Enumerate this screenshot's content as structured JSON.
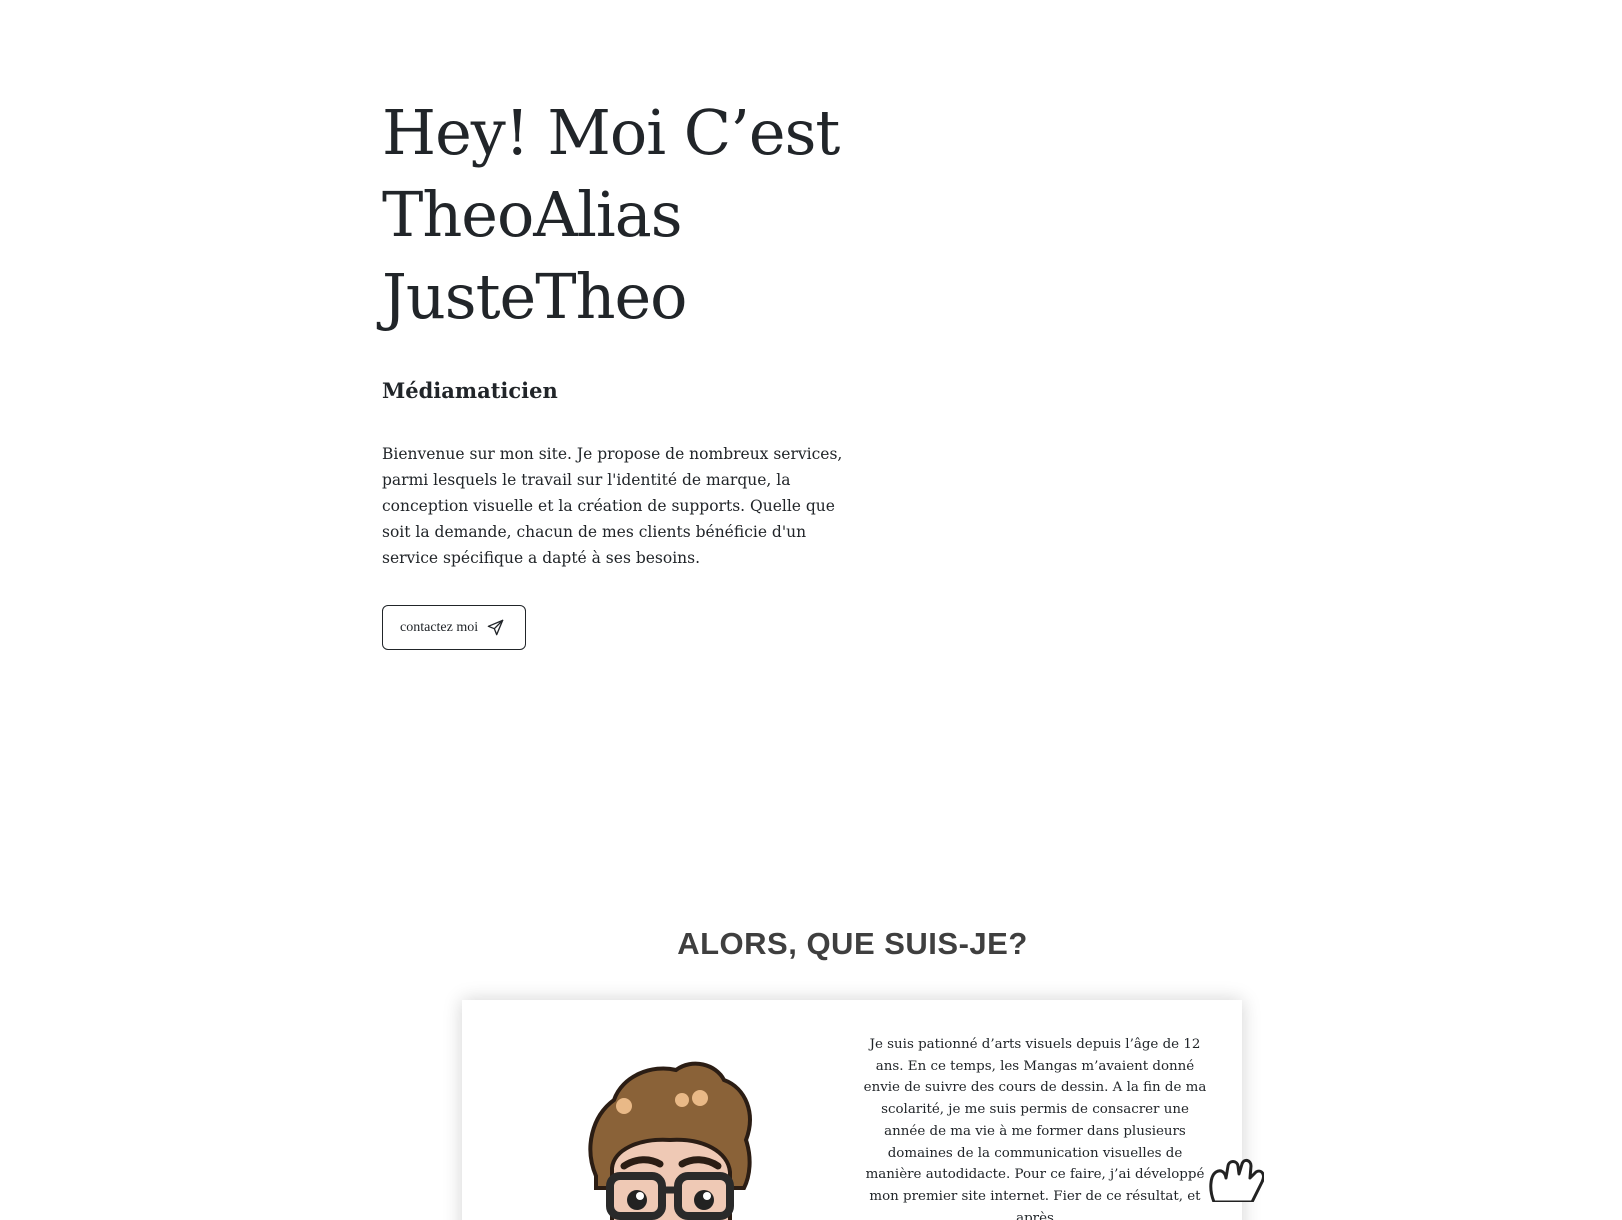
{
  "hero": {
    "title_line1": "Hey! Moi C’est",
    "title_line2": "TheoAlias",
    "title_line3": "JusteTheo",
    "subtitle": "Médiamaticien",
    "intro": "Bienvenue sur mon site. Je propose de nombreux services, parmi lesquels le travail sur l'identité de marque, la conception visuelle et la création de supports. Quelle que soit la demande, chacun de mes clients bénéficie d'un service spécifique a dapté à ses besoins.",
    "contact_label": "contactez moi",
    "contact_icon": "paper-plane-icon"
  },
  "about": {
    "heading": "ALORS, QUE SUIS-JE?",
    "avatar_icon": "cartoon-avatar-icon",
    "text": "Je suis pationné d’arts visuels depuis l’âge de 12 ans. En ce temps, les Mangas m’avaient donné envie de suivre des cours de dessin. A la fin de ma scolarité, je me suis permis de consacrer une année de ma vie à me former dans plusieurs domaines de la communication visuelles de manière autodidacte. Pour ce faire, j’ai développé mon premier site internet. Fier de ce résultat, et après",
    "hand_icon": "waving-hand-icon"
  },
  "colors": {
    "text": "#212529",
    "heading": "#3f3f3f",
    "background": "#ffffff"
  }
}
